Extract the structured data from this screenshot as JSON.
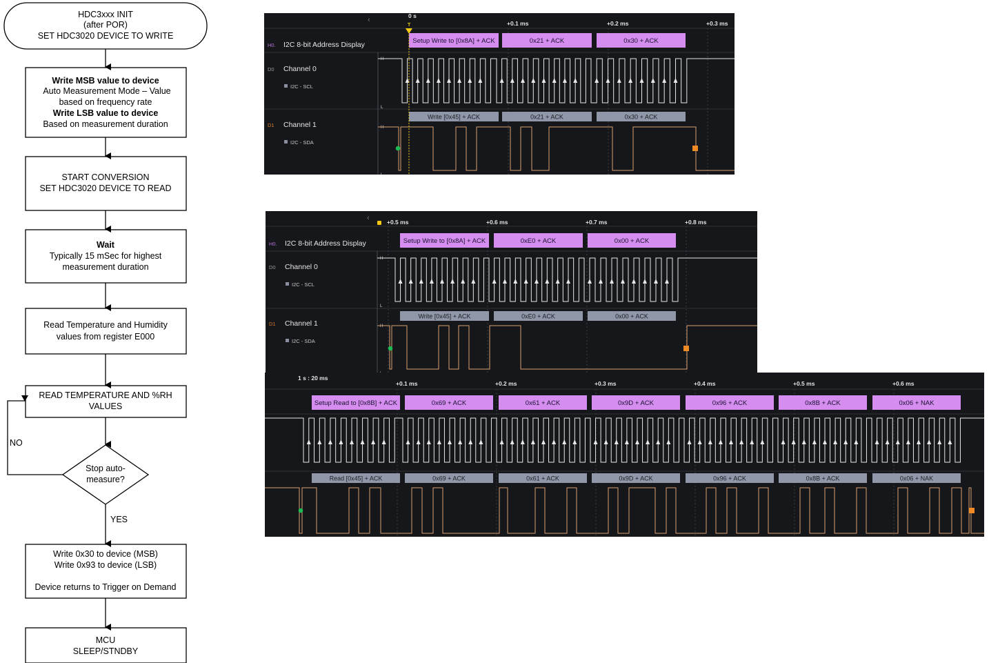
{
  "flowchart": {
    "start": [
      "HDC3xxx INIT",
      "(after POR)",
      "SET HDC3020 DEVICE TO WRITE"
    ],
    "box1": {
      "line1": "Write MSB value to device",
      "line2": "Auto Measurement Mode – Value",
      "line3": "based on frequency rate",
      "line4": "Write LSB value to device",
      "line5": "Based on measurement duration"
    },
    "box2": [
      "START CONVERSION",
      "SET HDC3020 DEVICE TO READ"
    ],
    "box3": {
      "title": "Wait",
      "line2": "Typically 15 mSec for highest",
      "line3": "measurement duration"
    },
    "box4": [
      "Read Temperature and Humidity",
      "values from register E000"
    ],
    "box5": [
      "READ TEMPERATURE AND %RH",
      "VALUES"
    ],
    "decision": [
      "Stop auto-",
      "measure?"
    ],
    "no_label": "NO",
    "yes_label": "YES",
    "box6": [
      "Write 0x30 to device (MSB)",
      "Write 0x93 to device (LSB)",
      "Device returns to Trigger on Demand"
    ],
    "end": [
      "MCU",
      "SLEEP/STNDBY"
    ]
  },
  "panel1": {
    "time_labels": [
      "0 s",
      "+0.1 ms",
      "+0.2 ms",
      "+0.3 ms"
    ],
    "trigger_label": "T",
    "analyzer": {
      "tag": "H0.",
      "name": "I2C 8-bit Address Display"
    },
    "ch0": {
      "tag": "D0",
      "name": "Channel 0",
      "sub": "I2C - SCL"
    },
    "ch1": {
      "tag": "D1",
      "name": "Channel 1",
      "sub": "I2C - SDA"
    },
    "decoded_top": [
      "Setup Write to [0x8A] + ACK",
      "0x21 + ACK",
      "0x30 + ACK"
    ],
    "decoded_sda": [
      "Write [0x45] + ACK",
      "0x21 + ACK",
      "0x30 + ACK"
    ]
  },
  "panel2": {
    "time_labels": [
      "+0.5 ms",
      "+0.6 ms",
      "+0.7 ms",
      "+0.8 ms"
    ],
    "analyzer": {
      "tag": "H0.",
      "name": "I2C 8-bit Address Display"
    },
    "ch0": {
      "tag": "D0",
      "name": "Channel 0",
      "sub": "I2C - SCL"
    },
    "ch1": {
      "tag": "D1",
      "name": "Channel 1",
      "sub": "I2C - SDA"
    },
    "decoded_top": [
      "Setup Write to [0x8A] + ACK",
      "0xE0 + ACK",
      "0x00 + ACK"
    ],
    "decoded_sda": [
      "Write [0x45] + ACK",
      "0xE0 + ACK",
      "0x00 + ACK"
    ]
  },
  "panel3": {
    "origin_label": "1 s : 20 ms",
    "time_labels": [
      "+0.1 ms",
      "+0.2 ms",
      "+0.3 ms",
      "+0.4 ms",
      "+0.5 ms",
      "+0.6 ms"
    ],
    "decoded_top": [
      "Setup Read to [0x8B] + ACK",
      "0x69 + ACK",
      "0x61 + ACK",
      "0x9D + ACK",
      "0x96 + ACK",
      "0x8B + ACK",
      "0x06 + NAK"
    ],
    "decoded_sda": [
      "Read [0x45] + ACK",
      "0x69 + ACK",
      "0x61 + ACK",
      "0x9D + ACK",
      "0x96 + ACK",
      "0x8B + ACK",
      "0x06 + NAK"
    ]
  },
  "colors": {
    "background": "#16171a",
    "clock_trace": "#e8e8e8",
    "data_trace": "#d9a070",
    "decoded_top": "#d58ef0",
    "decoded_sda": "#8f97a8",
    "start_marker": "#1db954",
    "stop_marker": "#f08a24",
    "trigger": "#f2c811"
  }
}
